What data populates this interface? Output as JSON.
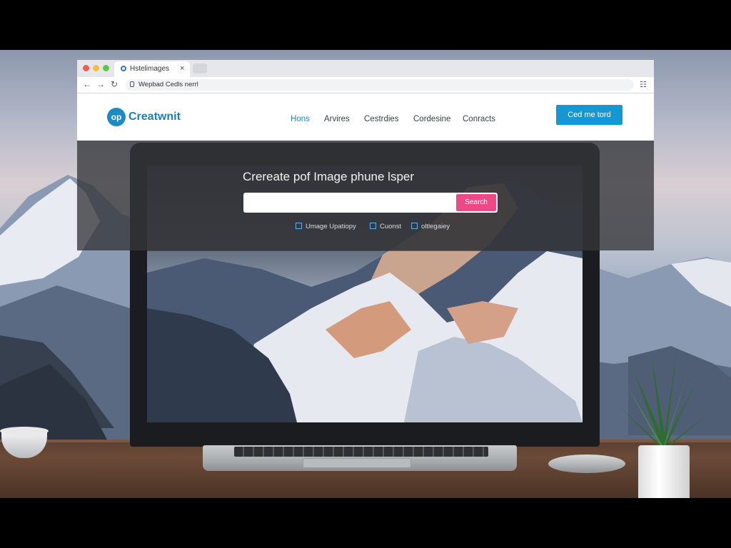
{
  "browser": {
    "tab_title": "Hstelimages",
    "tab_close": "×",
    "url": "Wepbad Cedls nerrl",
    "nav": {
      "back": "←",
      "forward": "→",
      "reload": "↻"
    },
    "extension_icon": "menu-icon"
  },
  "site": {
    "logo_mark": "op",
    "logo_text": "Creatwnit",
    "nav_items": [
      {
        "label": "Hons",
        "active": true
      },
      {
        "label": "Arvires",
        "active": false
      },
      {
        "label": "Cestrdies",
        "active": false
      },
      {
        "label": "Cordesine",
        "active": false
      },
      {
        "label": "Conracts",
        "active": false
      }
    ],
    "cta_label": "Ced me tord",
    "accent_color": "#1597d4"
  },
  "hero": {
    "title": "Crereate pof Image phune lsper",
    "search_value": "",
    "search_button": "Search",
    "search_button_color": "#ea4b87",
    "options": [
      {
        "label": "Umage Upatiopy",
        "icon": "image-icon"
      },
      {
        "label": "Cuonst",
        "icon": "doc-icon"
      },
      {
        "label": "oltlegaiey",
        "icon": "link-icon"
      }
    ]
  }
}
